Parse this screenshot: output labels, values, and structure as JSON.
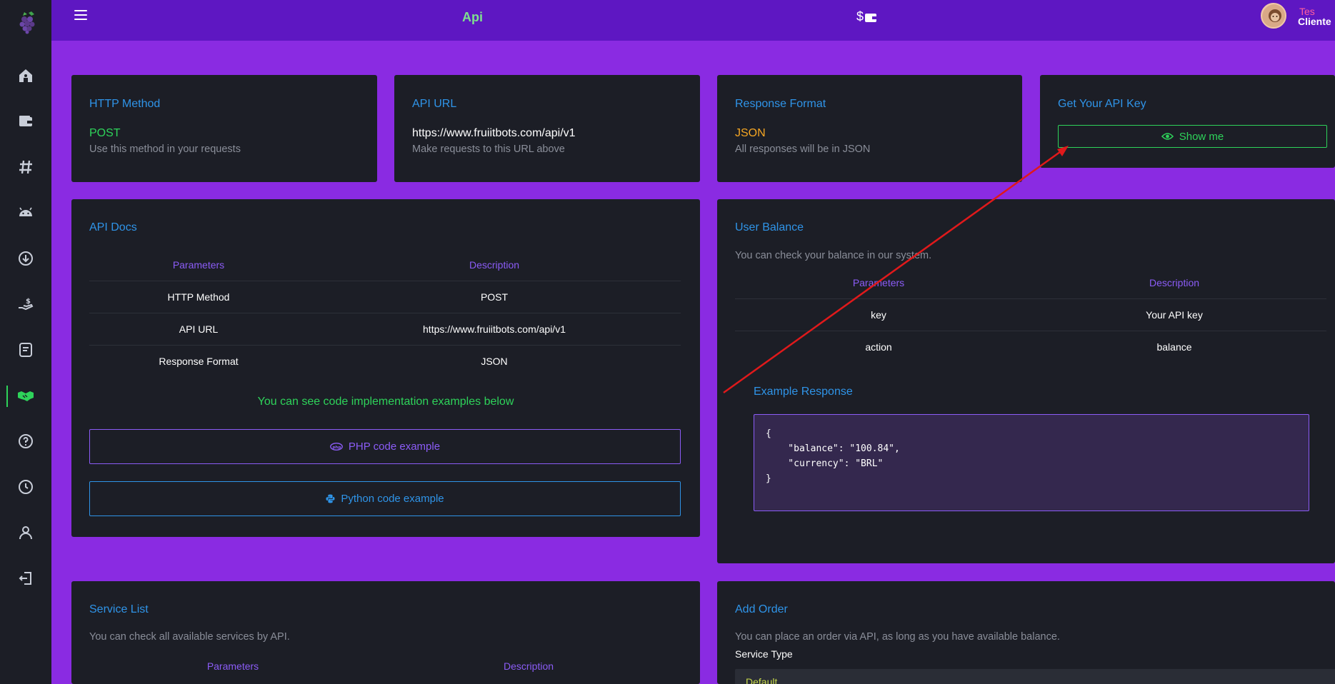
{
  "app": {
    "page_title": "Api",
    "balance_symbol": "$"
  },
  "user": {
    "first_name": "Tes",
    "last_name": "Cliente"
  },
  "sidebar": {
    "items": [
      {
        "icon": "home-icon"
      },
      {
        "icon": "wallet-icon"
      },
      {
        "icon": "hashtag-icon"
      },
      {
        "icon": "android-icon"
      },
      {
        "icon": "download-icon"
      },
      {
        "icon": "hand-money-icon"
      },
      {
        "icon": "orders-icon"
      },
      {
        "icon": "handshake-icon",
        "active": true
      },
      {
        "icon": "help-icon"
      },
      {
        "icon": "clock-icon"
      },
      {
        "icon": "user-icon"
      },
      {
        "icon": "logout-icon"
      }
    ]
  },
  "http_method": {
    "title": "HTTP Method",
    "value": "POST",
    "description": "Use this method in your requests"
  },
  "api_url": {
    "title": "API URL",
    "value": "https://www.fruiitbots.com/api/v1",
    "description": "Make requests to this URL above"
  },
  "response_format": {
    "title": "Response Format",
    "value": "JSON",
    "description": "All responses will be in JSON"
  },
  "api_key": {
    "title": "Get Your API Key",
    "button_label": "Show me"
  },
  "api_docs": {
    "title": "API Docs",
    "headers": [
      "Parameters",
      "Description"
    ],
    "rows": [
      [
        "HTTP Method",
        "POST"
      ],
      [
        "API URL",
        "https://www.fruiitbots.com/api/v1"
      ],
      [
        "Response Format",
        "JSON"
      ]
    ],
    "hint": "You can see code implementation examples below",
    "php_button": "PHP code example",
    "python_button": "Python code example"
  },
  "user_balance": {
    "title": "User Balance",
    "description": "You can check your balance in our system.",
    "headers": [
      "Parameters",
      "Description"
    ],
    "rows": [
      [
        "key",
        "Your API key"
      ],
      [
        "action",
        "balance"
      ]
    ],
    "example_title": "Example Response",
    "example_code": "{\n    \"balance\": \"100.84\",\n    \"currency\": \"BRL\"\n}"
  },
  "service_list": {
    "title": "Service List",
    "description": "You can check all available services by API.",
    "headers": [
      "Parameters",
      "Description"
    ]
  },
  "add_order": {
    "title": "Add Order",
    "description": "You can place an order via API, as long as you have available balance.",
    "service_type_label": "Service Type",
    "service_type_value": "Default"
  },
  "colors": {
    "background": "#8a2be2",
    "topbar": "#5e17c2",
    "card": "#1c1e26",
    "accent_blue": "#2f94e8",
    "accent_green": "#2ed35a",
    "accent_orange": "#f5a623",
    "accent_purple": "#8b5cf6",
    "annotation_arrow": "#e0191b"
  }
}
